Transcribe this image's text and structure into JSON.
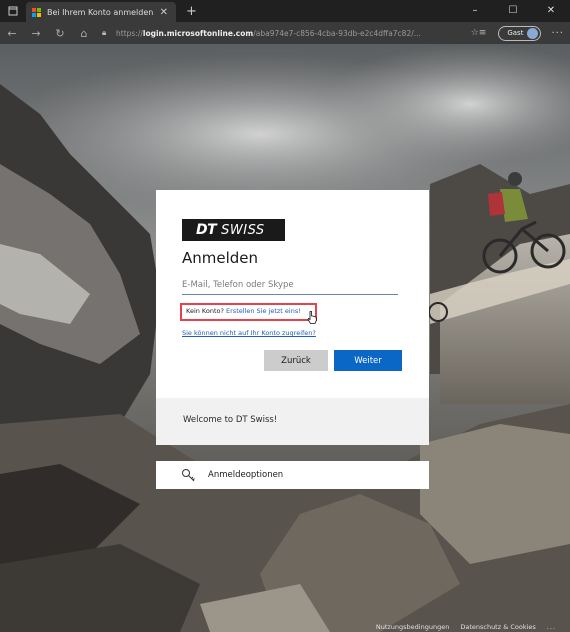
{
  "browser": {
    "tab_title": "Bei Ihrem Konto anmelden",
    "new_tab": "+",
    "url_prefix": "https://",
    "url_host": "login.microsoftonline.com",
    "url_path": "/aba974e7-c856-4cba-93db-e2c4dffa7c82/...",
    "guest_label": "Gast"
  },
  "card": {
    "logo_bold": "DT",
    "logo_text": "SWISS",
    "heading": "Anmelden",
    "email_placeholder": "E-Mail, Telefon oder Skype",
    "no_account_text": "Kein Konto?",
    "create_link": "Erstellen Sie jetzt eins!",
    "cant_access_link": "Sie können nicht auf Ihr Konto zugreifen?",
    "back_button": "Zurück",
    "next_button": "Weiter"
  },
  "welcome_text": "Welcome to DT Swiss!",
  "signin_options": "Anmeldeoptionen",
  "footer": {
    "terms": "Nutzungsbedingungen",
    "privacy": "Datenschutz & Cookies",
    "more": "..."
  },
  "colors": {
    "accent": "#0a67c5",
    "link": "#1f5bc4",
    "highlight": "#e0444e"
  }
}
